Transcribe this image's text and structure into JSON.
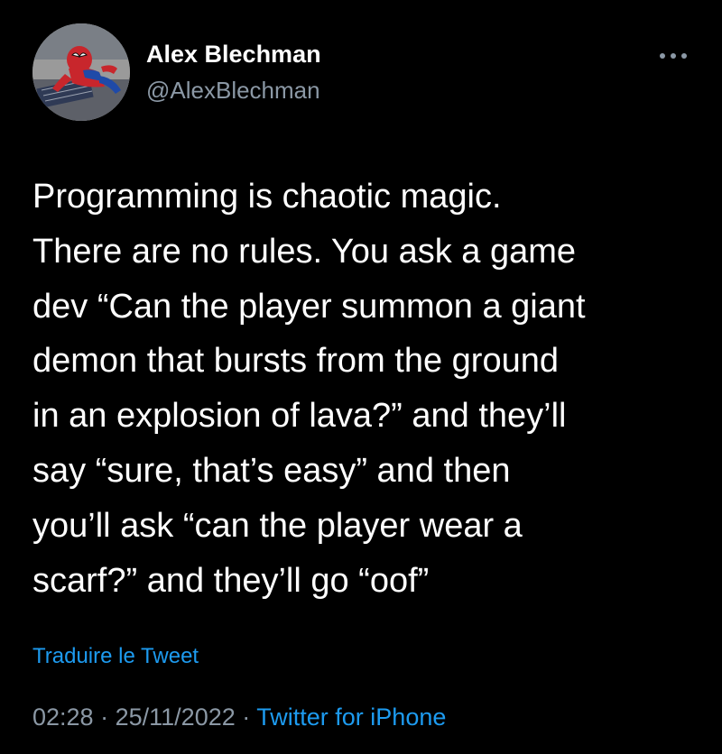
{
  "author": {
    "name": "Alex Blechman",
    "handle": "@AlexBlechman"
  },
  "avatar": {
    "icon": "spider-man-avatar"
  },
  "menu": {
    "icon": "more-options-icon"
  },
  "tweet": {
    "lines": [
      "Programming is chaotic magic.",
      "There are no rules. You ask a game",
      "dev “Can the player summon a giant",
      "demon that bursts from the ground",
      "in an explosion of lava?” and they’ll",
      "say “sure, that’s easy” and then",
      "you’ll ask “can the player wear a",
      "scarf?” and they’ll go “oof”"
    ]
  },
  "translate": {
    "label": "Traduire le Tweet"
  },
  "meta": {
    "time": "02:28",
    "separator": "·",
    "date": "25/11/2022",
    "source": "Twitter for iPhone"
  },
  "colors": {
    "background": "#000000",
    "text": "#ffffff",
    "muted": "#8b98a5",
    "link": "#1d9bf0"
  }
}
